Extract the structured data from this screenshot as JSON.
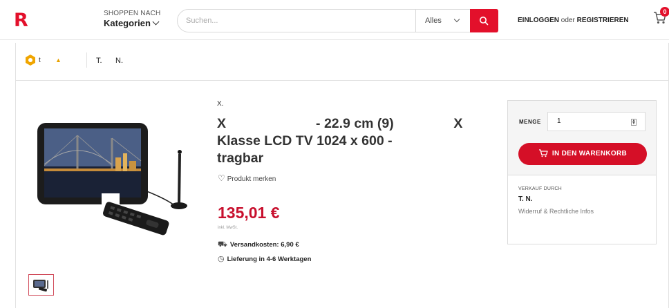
{
  "colors": {
    "brand": "#e3102b",
    "price": "#c8102e",
    "button": "#d50f27"
  },
  "header": {
    "logo": "R",
    "shop_small": "SHOPPEN NACH",
    "shop_big": "Kategorien",
    "search_placeholder": "Suchen...",
    "search_scope": "Alles",
    "login": "EINLOGGEN",
    "or": "oder",
    "register": "REGISTRIEREN",
    "cart_count": "0"
  },
  "breadcrumb": {
    "t1": "t",
    "t2": "T.",
    "t3": "N."
  },
  "product": {
    "brand": "X.",
    "title_line1": "X                        - 22.9 cm (9)                X",
    "title_line2": "Klasse LCD TV 1024 x 600 -",
    "title_line3": "tragbar",
    "favorite": "Produkt merken",
    "price": "135,01 €",
    "tax_note": "inkl. MwSt.",
    "shipping": "Versandkosten: 6,90 €",
    "delivery": "Lieferung in 4-6 Werktagen"
  },
  "buybox": {
    "qty_label": "MENGE",
    "qty_value": "1",
    "cart_button": "IN DEN WARENKORB",
    "seller_label": "VERKAUF DURCH",
    "seller_name": "T.   N.",
    "legal": "Widerruf & Rechtliche Infos"
  },
  "icons": {
    "search": "search-icon",
    "cart": "cart-icon",
    "heart": "heart-icon",
    "truck": "truck-icon",
    "clock": "clock-icon"
  }
}
